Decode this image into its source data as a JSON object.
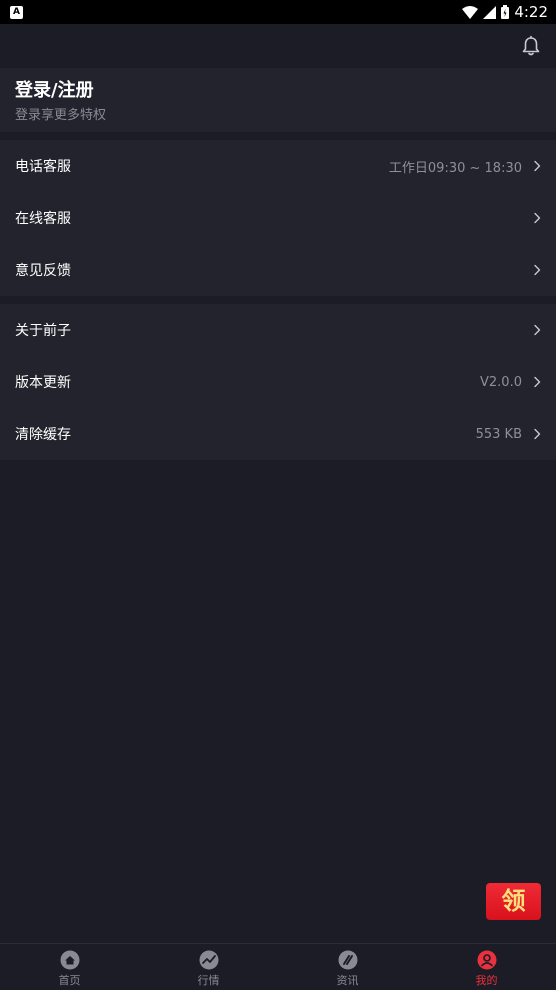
{
  "status_bar": {
    "time": "4:22",
    "notification": "A"
  },
  "login": {
    "title": "登录/注册",
    "subtitle": "登录享更多特权"
  },
  "groups": [
    [
      {
        "label": "电话客服",
        "value": "工作日09:30 ~ 18:30"
      },
      {
        "label": "在线客服",
        "value": ""
      },
      {
        "label": "意见反馈",
        "value": ""
      }
    ],
    [
      {
        "label": "关于前子",
        "value": ""
      },
      {
        "label": "版本更新",
        "value": "V2.0.0"
      },
      {
        "label": "清除缓存",
        "value": "553 KB"
      }
    ]
  ],
  "gift_button": {
    "label": "领"
  },
  "tabs": [
    {
      "label": "首页",
      "icon": "home-icon",
      "active": false
    },
    {
      "label": "行情",
      "icon": "chart-icon",
      "active": false
    },
    {
      "label": "资讯",
      "icon": "news-icon",
      "active": false
    },
    {
      "label": "我的",
      "icon": "profile-icon",
      "active": true
    }
  ],
  "colors": {
    "accent": "#e8323d",
    "background": "#1c1c26",
    "card": "#23232d"
  }
}
